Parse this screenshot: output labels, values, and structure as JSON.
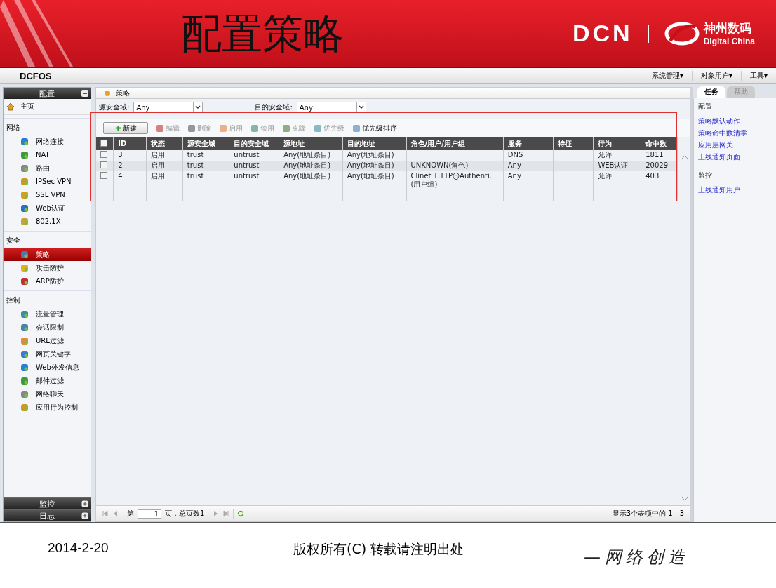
{
  "slide": {
    "title": "配置策略",
    "brand": {
      "logo": "DCN",
      "name_cn": "神州数码",
      "name_en": "Digital China"
    },
    "date": "2014-2-20",
    "copyright": "版权所有(C) 转载请注明出处",
    "slogan": "—网络创造"
  },
  "app": {
    "product": "DCFOS",
    "menus": [
      "系统管理▾",
      "对象用户▾",
      "工具▾"
    ]
  },
  "sidebar": {
    "sections": [
      {
        "title": "配置",
        "expanded": true,
        "items": [
          {
            "label": "主页",
            "selected": false
          }
        ],
        "groups": [
          {
            "title": "网络",
            "items": [
              {
                "label": "网络连接",
                "selected": false
              },
              {
                "label": "NAT",
                "selected": false
              },
              {
                "label": "路由",
                "selected": false
              },
              {
                "label": "IPSec VPN",
                "selected": false
              },
              {
                "label": "SSL VPN",
                "selected": false
              },
              {
                "label": "Web认证",
                "selected": false
              },
              {
                "label": "802.1X",
                "selected": false
              }
            ]
          },
          {
            "title": "安全",
            "items": [
              {
                "label": "策略",
                "selected": true
              },
              {
                "label": "攻击防护",
                "selected": false
              },
              {
                "label": "ARP防护",
                "selected": false
              }
            ]
          },
          {
            "title": "控制",
            "items": [
              {
                "label": "流量管理",
                "selected": false
              },
              {
                "label": "会话限制",
                "selected": false
              },
              {
                "label": "URL过滤",
                "selected": false
              },
              {
                "label": "网页关键字",
                "selected": false
              },
              {
                "label": "Web外发信息",
                "selected": false
              },
              {
                "label": "邮件过滤",
                "selected": false
              },
              {
                "label": "网络聊天",
                "selected": false
              },
              {
                "label": "应用行为控制",
                "selected": false
              }
            ]
          }
        ]
      },
      {
        "title": "监控",
        "expanded": false
      },
      {
        "title": "日志",
        "expanded": false
      }
    ]
  },
  "main": {
    "breadcrumb": "策略",
    "filters": [
      {
        "label": "源安全域:",
        "value": "Any"
      },
      {
        "label": "目的安全域:",
        "value": "Any"
      }
    ],
    "toolbar": [
      {
        "label": "新建",
        "disabled": false,
        "kind": "button"
      },
      {
        "label": "编辑",
        "disabled": true,
        "kind": "tool"
      },
      {
        "label": "删除",
        "disabled": true,
        "kind": "tool"
      },
      {
        "label": "启用",
        "disabled": true,
        "kind": "tool"
      },
      {
        "label": "禁用",
        "disabled": true,
        "kind": "tool"
      },
      {
        "label": "克隆",
        "disabled": true,
        "kind": "tool"
      },
      {
        "label": "优先级",
        "disabled": true,
        "kind": "tool"
      },
      {
        "label": "优先级排序",
        "disabled": false,
        "kind": "tool"
      }
    ],
    "table": {
      "all_checked": false,
      "columns": [
        "ID",
        "状态",
        "源安全域",
        "目的安全域",
        "源地址",
        "目的地址",
        "角色/用户/用户组",
        "服务",
        "特征",
        "行为",
        "命中数"
      ],
      "rows": [
        {
          "checked": false,
          "cells": [
            "3",
            "启用",
            "trust",
            "untrust",
            "Any(地址条目)",
            "Any(地址条目)",
            "",
            "DNS",
            "",
            "允许",
            "1811"
          ]
        },
        {
          "checked": false,
          "cells": [
            "2",
            "启用",
            "trust",
            "untrust",
            "Any(地址条目)",
            "Any(地址条目)",
            "UNKNOWN(角色)",
            "Any",
            "",
            "WEB认证",
            "20029"
          ]
        },
        {
          "checked": false,
          "cells": [
            "4",
            "启用",
            "trust",
            "untrust",
            "Any(地址条目)",
            "Any(地址条目)",
            "Clinet_HTTP@Authenti... (用户组)",
            "Any",
            "",
            "允许",
            "403"
          ]
        }
      ]
    },
    "pager": {
      "prefix": "第",
      "page": "1",
      "suffix": "页，总页数1",
      "summary": "显示3个表项中的 1 - 3"
    }
  },
  "tasks": {
    "tabs": [
      {
        "label": "任务",
        "selected": true
      },
      {
        "label": "帮助",
        "selected": false
      }
    ],
    "groups": [
      {
        "title": "配置",
        "links": [
          "策略默认动作",
          "策略命中数清零",
          "应用层网关",
          "上线通知页面"
        ]
      },
      {
        "title": "监控",
        "links": [
          "上线通知用户"
        ]
      }
    ]
  }
}
